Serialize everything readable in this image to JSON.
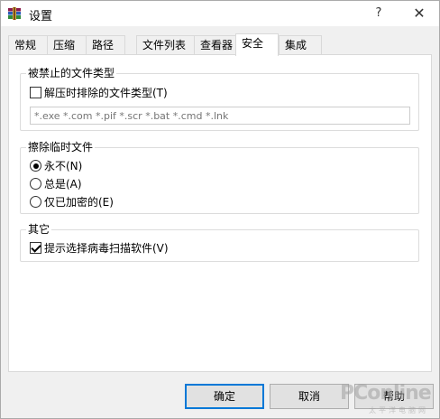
{
  "window": {
    "title": "设置",
    "help_label": "?",
    "close_label": "✕"
  },
  "tabs": [
    {
      "label": "常规"
    },
    {
      "label": "压缩"
    },
    {
      "label": "路径"
    },
    {
      "label": "文件列表"
    },
    {
      "label": "查看器"
    },
    {
      "label": "安全"
    },
    {
      "label": "集成"
    }
  ],
  "active_tab": "安全",
  "forbidden_types": {
    "title": "被禁止的文件类型",
    "checkbox_label": "解压时排除的文件类型(T)",
    "checkbox_checked": false,
    "input_placeholder": "*.exe *.com *.pif *.scr *.bat *.cmd *.lnk"
  },
  "wipe_temp": {
    "title": "擦除临时文件",
    "options": [
      {
        "label": "永不(N)",
        "selected": true
      },
      {
        "label": "总是(A)",
        "selected": false
      },
      {
        "label": "仅已加密的(E)",
        "selected": false
      }
    ]
  },
  "other": {
    "title": "其它",
    "checkbox_label": "提示选择病毒扫描软件(V)",
    "checkbox_checked": true
  },
  "buttons": {
    "ok": "确定",
    "cancel": "取消",
    "help": "帮助"
  },
  "watermark": {
    "text": "PConline",
    "sub": "太平洋电脑网"
  },
  "colors": {
    "accent": "#0078d7",
    "window_bg": "#f0f0f0",
    "panel_bg": "#ffffff"
  }
}
